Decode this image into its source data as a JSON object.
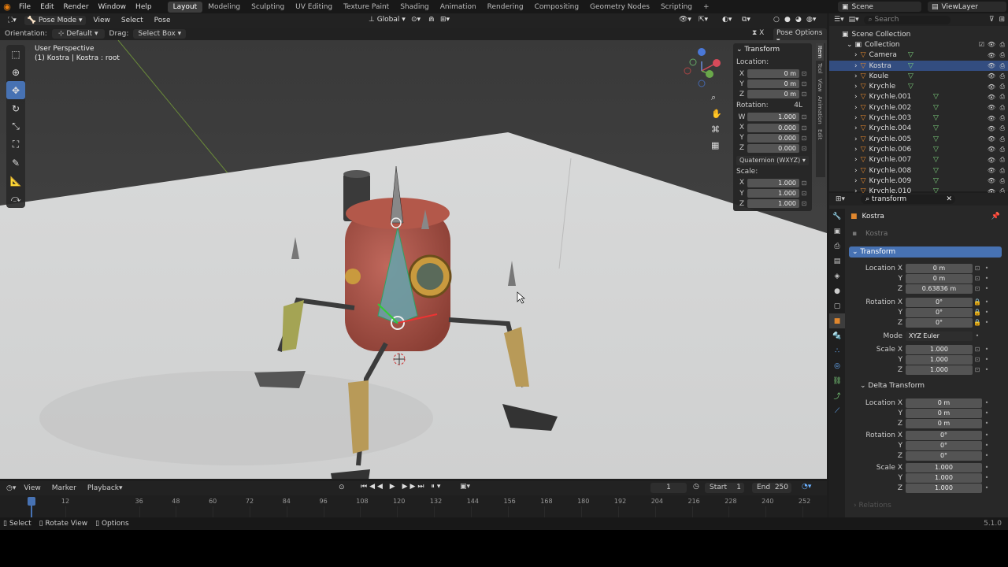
{
  "topbar": {
    "menus": [
      "File",
      "Edit",
      "Render",
      "Window",
      "Help"
    ],
    "workspaces": [
      "Layout",
      "Modeling",
      "Sculpting",
      "UV Editing",
      "Texture Paint",
      "Shading",
      "Animation",
      "Rendering",
      "Compositing",
      "Geometry Nodes",
      "Scripting",
      "+"
    ],
    "scene": "Scene",
    "view_layer": "ViewLayer"
  },
  "header3d": {
    "mode": "Pose Mode",
    "menus": [
      "View",
      "Select",
      "Pose"
    ],
    "transform_orientation": "Global"
  },
  "toolhdr": {
    "orientation_label": "Orientation:",
    "orientation_value": "Default",
    "drag_label": "Drag:",
    "drag_value": "Select Box",
    "pose_options": "Pose Options"
  },
  "viewport": {
    "perspective": "User Perspective",
    "info": "(1) Kostra | Kostra : root"
  },
  "npanel": {
    "title": "Transform",
    "location_label": "Location:",
    "location": [
      {
        "axis": "X",
        "value": "0 m"
      },
      {
        "axis": "Y",
        "value": "0 m"
      },
      {
        "axis": "Z",
        "value": "0 m"
      }
    ],
    "rotation_label": "Rotation:",
    "rotation_mode_short": "4L",
    "rotation": [
      {
        "axis": "W",
        "value": "1.000"
      },
      {
        "axis": "X",
        "value": "0.000"
      },
      {
        "axis": "Y",
        "value": "0.000"
      },
      {
        "axis": "Z",
        "value": "0.000"
      }
    ],
    "rotation_mode": "Quaternion (WXYZ)",
    "scale_label": "Scale:",
    "scale": [
      {
        "axis": "X",
        "value": "1.000"
      },
      {
        "axis": "Y",
        "value": "1.000"
      },
      {
        "axis": "Z",
        "value": "1.000"
      }
    ],
    "tabs": [
      "Item",
      "Tool",
      "View",
      "Animation",
      "Edit"
    ]
  },
  "outliner": {
    "search_placeholder": "Search",
    "root": "Scene Collection",
    "collection": "Collection",
    "items": [
      "Camera",
      "Kostra",
      "Koule",
      "Krychle",
      "Krychle.001",
      "Krychle.002",
      "Krychle.003",
      "Krychle.004",
      "Krychle.005",
      "Krychle.006",
      "Krychle.007",
      "Krychle.008",
      "Krychle.009",
      "Krychle.010"
    ],
    "selected": "Kostra"
  },
  "properties": {
    "search_value": "transform",
    "object_name": "Kostra",
    "data_name": "Kostra",
    "panel": "Transform",
    "location_x_label": "Location X",
    "location": [
      "0 m",
      "0 m",
      "0.63836 m"
    ],
    "rotation_x_label": "Rotation X",
    "rotation": [
      "0°",
      "0°",
      "0°"
    ],
    "mode_label": "Mode",
    "mode_value": "XYZ Euler",
    "scale_x_label": "Scale X",
    "scale": [
      "1.000",
      "1.000",
      "1.000"
    ],
    "delta_panel": "Delta Transform",
    "delta_location": [
      "0 m",
      "0 m",
      "0 m"
    ],
    "delta_rotation": [
      "0°",
      "0°",
      "0°"
    ],
    "delta_scale": [
      "1.000",
      "1.000",
      "1.000"
    ],
    "relations": "Relations",
    "axis_y": "Y",
    "axis_z": "Z"
  },
  "timeline": {
    "menus": [
      "View",
      "Marker",
      "Playback"
    ],
    "current_frame": "1",
    "start_label": "Start",
    "start": "1",
    "end_label": "End",
    "end": "250",
    "ticks": [
      "1",
      "12",
      "36",
      "48",
      "60",
      "72",
      "84",
      "96",
      "108",
      "120",
      "132",
      "144",
      "156",
      "168",
      "180",
      "192",
      "204",
      "216",
      "228",
      "240",
      "252"
    ]
  },
  "statusbar": {
    "items": [
      "Select",
      "Rotate View",
      "Options"
    ],
    "version": "5.1.0"
  }
}
